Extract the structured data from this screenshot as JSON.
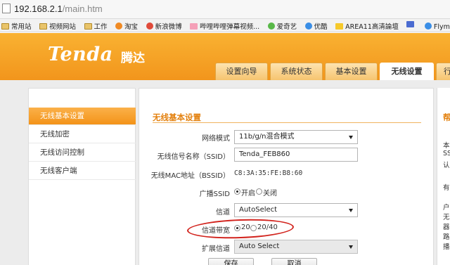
{
  "browser": {
    "address_host": "192.168.2.1",
    "address_path": "/main.htm",
    "bookmarks": [
      {
        "label": "常用站",
        "icon": "folder-icon"
      },
      {
        "label": "视频网站",
        "icon": "folder-icon"
      },
      {
        "label": "工作",
        "icon": "folder-icon"
      },
      {
        "label": "淘宝",
        "icon": "taobao-icon"
      },
      {
        "label": "新浪微博",
        "icon": "weibo-icon"
      },
      {
        "label": "哔哩哔哩弹幕视频...",
        "icon": "bilibili-icon"
      },
      {
        "label": "爱奇艺",
        "icon": "iqiyi-icon"
      },
      {
        "label": "优酷",
        "icon": "youku-icon"
      },
      {
        "label": "AREA11高清論壇",
        "icon": "area11-icon"
      },
      {
        "label": "",
        "icon": "grid-icon"
      },
      {
        "label": "Flyme社区",
        "icon": "flyme-icon"
      },
      {
        "label": "",
        "icon": "navy-icon"
      }
    ]
  },
  "brand": {
    "logo": "Tenda",
    "logo_cn": "腾达"
  },
  "tabs": [
    "设置向导",
    "系统状态",
    "基本设置",
    "无线设置",
    "行"
  ],
  "sidebar": {
    "items": [
      "无线基本设置",
      "无线加密",
      "无线访问控制",
      "无线客户端"
    ],
    "active_index": 0
  },
  "form": {
    "title": "无线基本设置",
    "network_mode_label": "网络模式",
    "network_mode_value": "11b/g/n混合模式",
    "ssid_label": "无线信号名称（SSID）",
    "ssid_value": "Tenda_FEB860",
    "mac_label": "无线MAC地址（BSSID）",
    "mac_value": "C8:3A:35:FE:B8:60",
    "broadcast_label": "广播SSID",
    "broadcast_on": "开启",
    "broadcast_off": "关闭",
    "channel_label": "信道",
    "channel_value": "AutoSelect",
    "bandwidth_label": "信道带宽",
    "bandwidth_opt1": "20",
    "bandwidth_opt2": "20/40",
    "ext_channel_label": "扩展信道",
    "ext_channel_value": "Auto Select",
    "save_label": "保存",
    "cancel_label": "取消"
  },
  "help": {
    "title": "帮",
    "lines": [
      "本",
      "SS",
      "认",
      "有",
      "户",
      "无",
      "器",
      "路",
      "播"
    ]
  },
  "colors": {
    "accent": "#f39318",
    "highlight": "#d2231d"
  }
}
